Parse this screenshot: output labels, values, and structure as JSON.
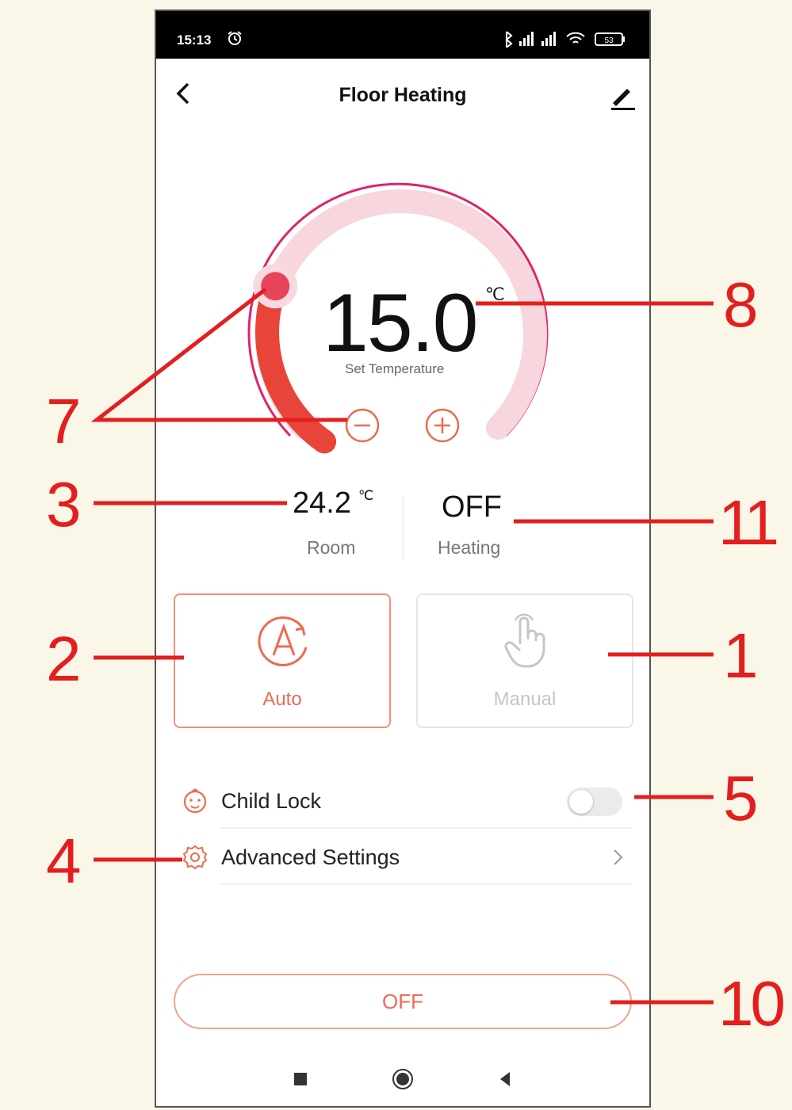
{
  "status_bar": {
    "time": "15:13",
    "battery": "53"
  },
  "header": {
    "title": "Floor Heating"
  },
  "thermostat": {
    "set_temperature": "15.0",
    "unit": "℃",
    "set_label": "Set Temperature",
    "level_fraction": 0.3
  },
  "info": {
    "room": {
      "value": "24.2",
      "unit": "℃",
      "label": "Room"
    },
    "heating": {
      "value": "OFF",
      "label": "Heating"
    }
  },
  "modes": [
    {
      "label": "Auto",
      "selected": true
    },
    {
      "label": "Manual",
      "selected": false
    }
  ],
  "settings": {
    "child_lock": {
      "label": "Child Lock",
      "enabled": false
    },
    "advanced": {
      "label": "Advanced Settings"
    }
  },
  "power_button": {
    "label": "OFF"
  },
  "callouts": [
    "7",
    "8",
    "3",
    "11",
    "2",
    "1",
    "5",
    "4",
    "10"
  ],
  "colors": {
    "accent": "#ec6b50",
    "callout": "#e41e1e",
    "arc_dark": "#e8443a",
    "arc_light": "#f8cfd7"
  }
}
